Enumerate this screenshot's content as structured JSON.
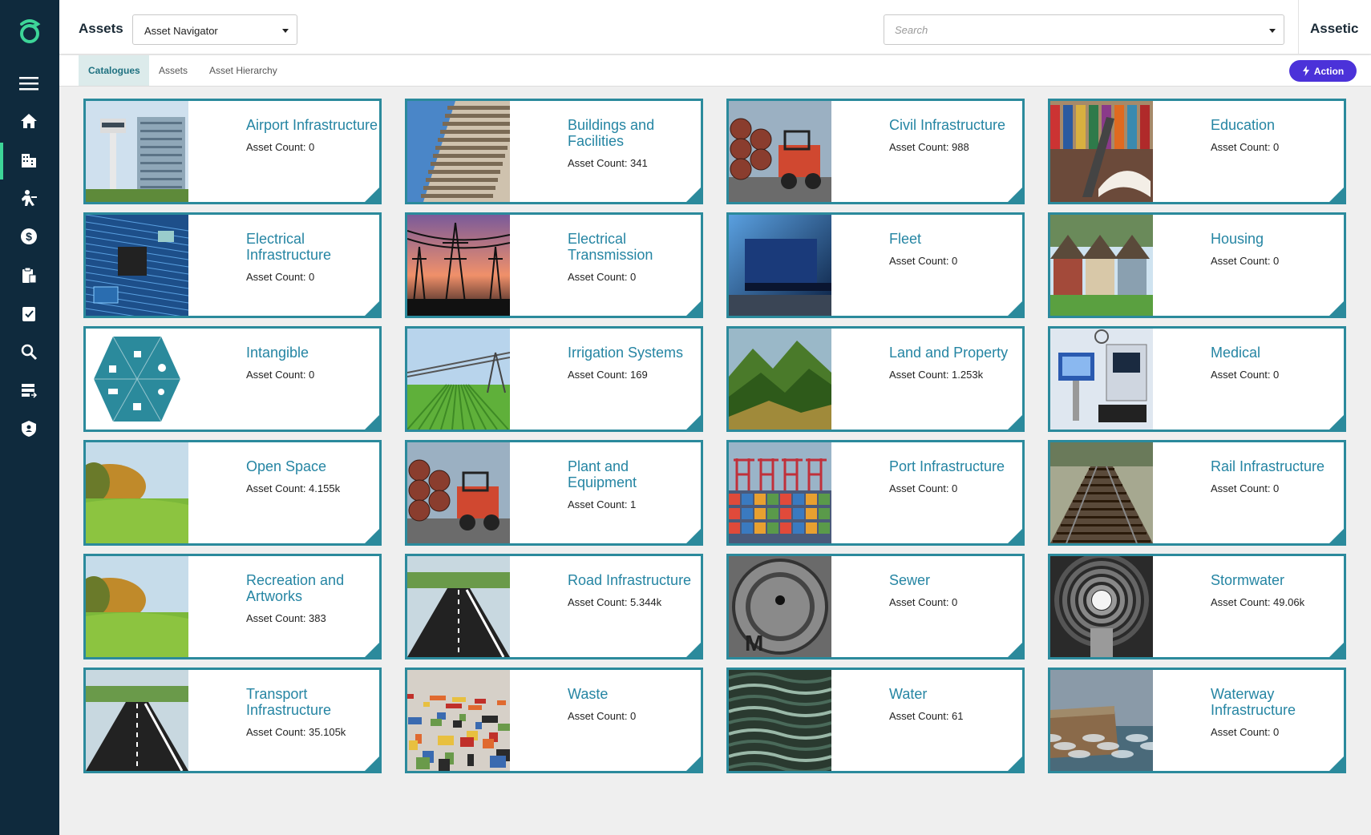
{
  "header": {
    "title": "Assets",
    "navigator_value": "Asset Navigator",
    "search_placeholder": "Search",
    "brand": "Assetic"
  },
  "subnav": {
    "tabs": [
      "Catalogues",
      "Assets",
      "Asset Hierarchy"
    ],
    "active_tab": "Catalogues",
    "action_label": "Action"
  },
  "sidebar": {
    "items": [
      "menu-icon",
      "home-icon",
      "buildings-icon",
      "worker-icon",
      "finance-icon",
      "clipboard-icon",
      "task-icon",
      "search-icon",
      "data-icon",
      "shield-icon"
    ],
    "active_item": "buildings-icon"
  },
  "colors": {
    "sidebar": "#0f2a3d",
    "accent_green": "#3dd598",
    "card_border": "#2b8a9c",
    "card_title": "#2585a3",
    "action": "#4b32d9"
  },
  "catalogues": [
    {
      "name": "Airport Infrastructure",
      "count": "Asset Count: 0",
      "image": "airport-tower"
    },
    {
      "name": "Buildings and Facilities",
      "count": "Asset Count: 341",
      "image": "building"
    },
    {
      "name": "Civil Infrastructure",
      "count": "Asset Count: 988",
      "image": "forklift-pipes"
    },
    {
      "name": "Education",
      "count": "Asset Count: 0",
      "image": "books-laptop"
    },
    {
      "name": "Electrical Infrastructure",
      "count": "Asset Count: 0",
      "image": "circuit-board"
    },
    {
      "name": "Electrical Transmission",
      "count": "Asset Count: 0",
      "image": "power-pylons"
    },
    {
      "name": "Fleet",
      "count": "Asset Count: 0",
      "image": "truck"
    },
    {
      "name": "Housing",
      "count": "Asset Count: 0",
      "image": "houses"
    },
    {
      "name": "Intangible",
      "count": "Asset Count: 0",
      "image": "hexagon-icons"
    },
    {
      "name": "Irrigation Systems",
      "count": "Asset Count: 169",
      "image": "irrigation"
    },
    {
      "name": "Land and Property",
      "count": "Asset Count: 1.253k",
      "image": "mountains"
    },
    {
      "name": "Medical",
      "count": "Asset Count: 0",
      "image": "medical-equipment"
    },
    {
      "name": "Open Space",
      "count": "Asset Count: 4.155k",
      "image": "meadow"
    },
    {
      "name": "Plant and Equipment",
      "count": "Asset Count: 1",
      "image": "forklift-pipes"
    },
    {
      "name": "Port Infrastructure",
      "count": "Asset Count: 0",
      "image": "port-cranes"
    },
    {
      "name": "Rail Infrastructure",
      "count": "Asset Count: 0",
      "image": "rail-tracks"
    },
    {
      "name": "Recreation and Artworks",
      "count": "Asset Count: 383",
      "image": "meadow"
    },
    {
      "name": "Road Infrastructure",
      "count": "Asset Count: 5.344k",
      "image": "road"
    },
    {
      "name": "Sewer",
      "count": "Asset Count: 0",
      "image": "manhole"
    },
    {
      "name": "Stormwater",
      "count": "Asset Count: 49.06k",
      "image": "pipe-tunnel"
    },
    {
      "name": "Transport Infrastructure",
      "count": "Asset Count: 35.105k",
      "image": "road"
    },
    {
      "name": "Waste",
      "count": "Asset Count: 0",
      "image": "garbage"
    },
    {
      "name": "Water",
      "count": "Asset Count: 61",
      "image": "water"
    },
    {
      "name": "Waterway Infrastructure",
      "count": "Asset Count: 0",
      "image": "sea-wall"
    }
  ]
}
